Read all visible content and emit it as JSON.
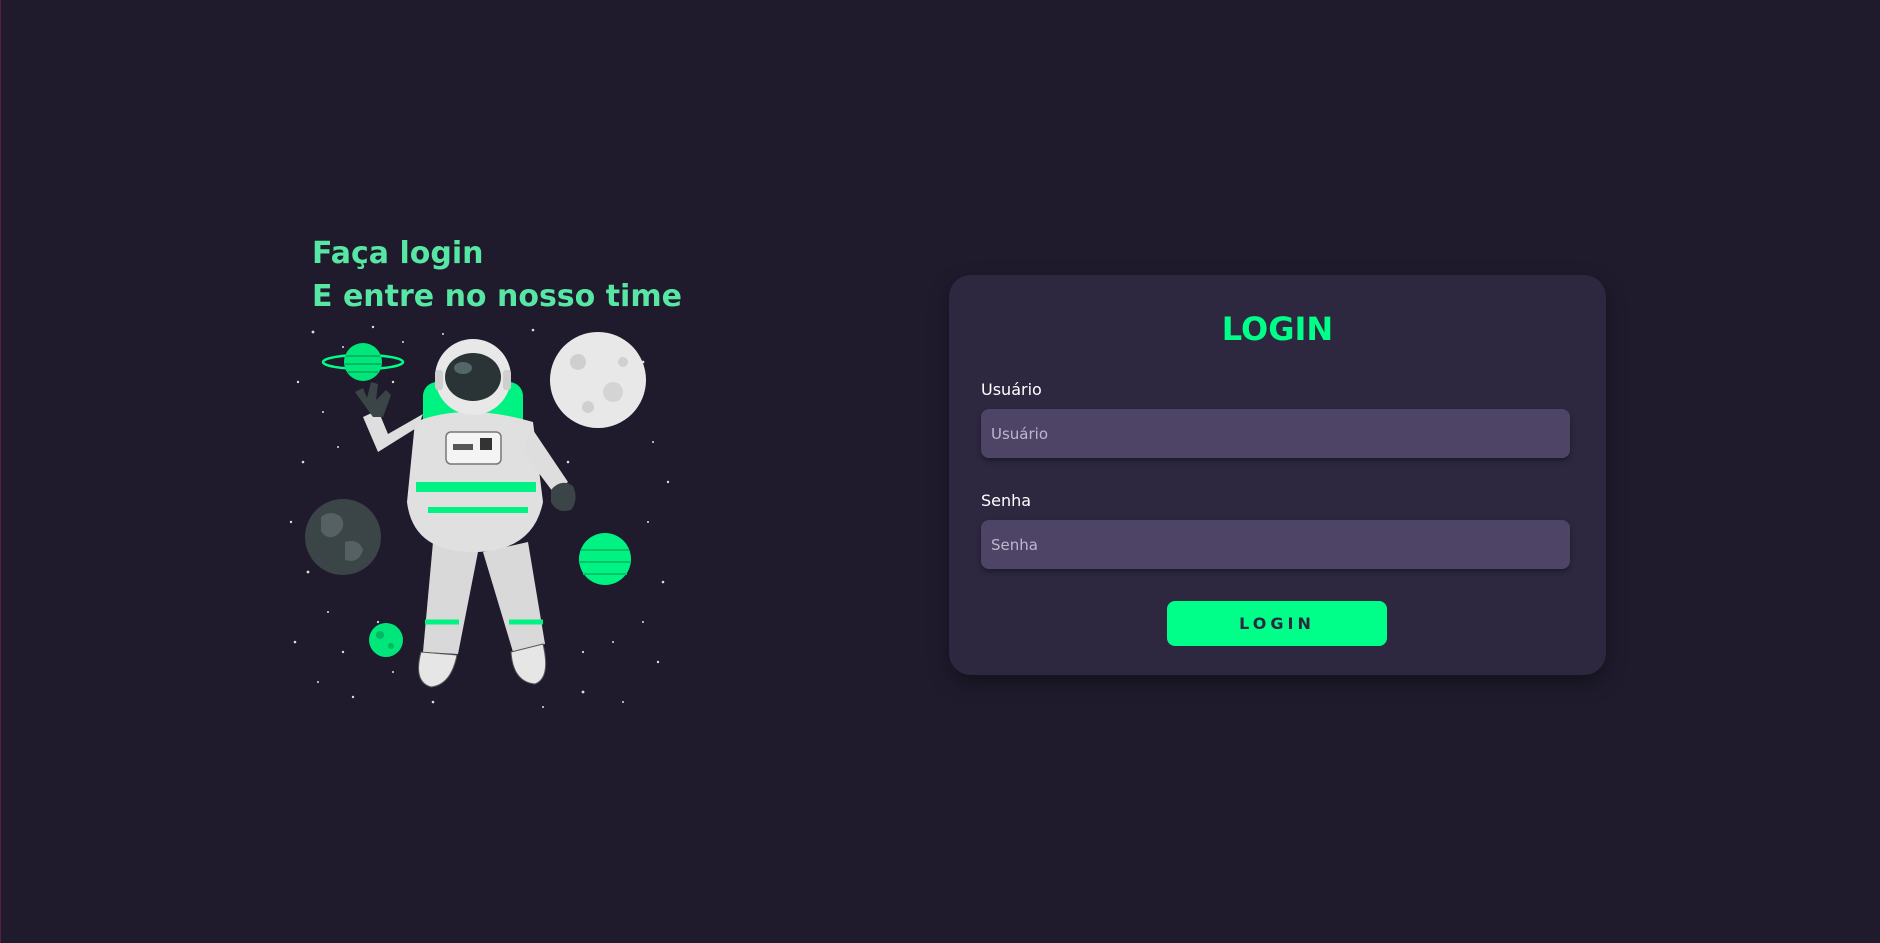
{
  "hero": {
    "line1": "Faça login",
    "line2": "E entre no nosso time",
    "illustration": "astronaut-floating-in-space-illustration"
  },
  "login": {
    "title": "LOGIN",
    "username_label": "Usuário",
    "username_placeholder": "Usuário",
    "username_value": "",
    "password_label": "Senha",
    "password_placeholder": "Senha",
    "password_value": "",
    "button_label": "LOGIN"
  },
  "colors": {
    "background": "#1f1b2d",
    "card": "#2d2840",
    "input": "#4e4566",
    "accent": "#00ff88",
    "headline": "#58e6a4"
  }
}
